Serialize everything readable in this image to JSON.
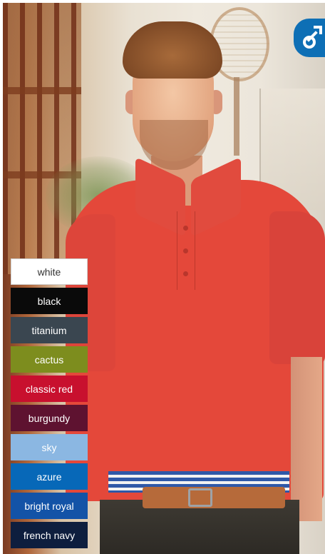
{
  "product": {
    "gender_icon": "male-symbol-icon",
    "shirt_color": "#e4483a"
  },
  "swatches": [
    {
      "label": "white",
      "color": "#ffffff"
    },
    {
      "label": "black",
      "color": "#0a0a0a"
    },
    {
      "label": "titanium",
      "color": "#3a4650"
    },
    {
      "label": "cactus",
      "color": "#7d8d1e"
    },
    {
      "label": "classic red",
      "color": "#c8102e"
    },
    {
      "label": "burgundy",
      "color": "#5e1230"
    },
    {
      "label": "sky",
      "color": "#8bb7e2"
    },
    {
      "label": "azure",
      "color": "#0768b8"
    },
    {
      "label": "bright royal",
      "color": "#1353a7"
    },
    {
      "label": "french navy",
      "color": "#0e1e3e"
    }
  ]
}
